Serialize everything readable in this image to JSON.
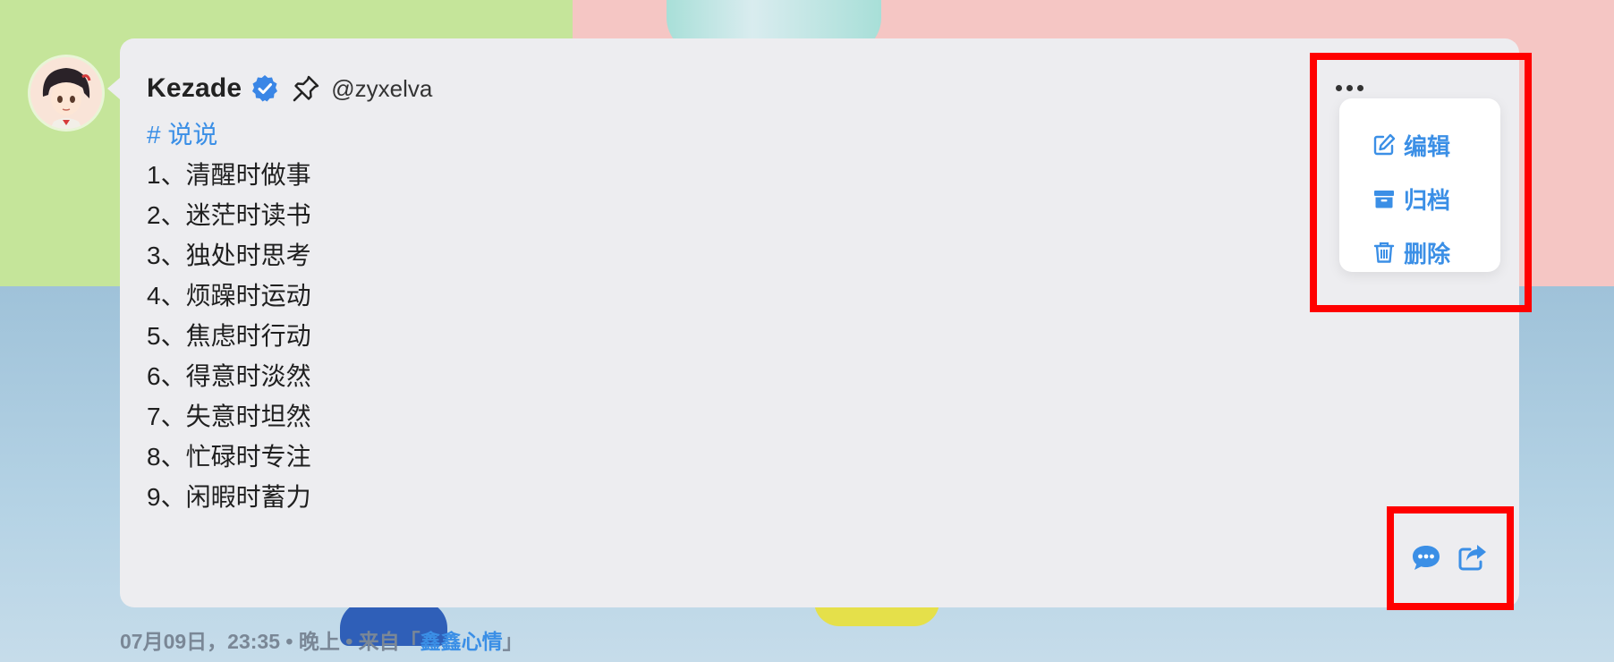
{
  "post": {
    "author_name": "Kezade",
    "handle": "@zyxelva",
    "tag": "# 说说",
    "lines": [
      "1、清醒时做事",
      "2、迷茫时读书",
      "3、独处时思考",
      "4、烦躁时运动",
      "5、焦虑时行动",
      "6、得意时淡然",
      "7、失意时坦然",
      "8、忙碌时专注",
      "9、闲暇时蓄力"
    ]
  },
  "menu": {
    "edit": "编辑",
    "archive": "归档",
    "delete": "删除"
  },
  "footer": {
    "meta": "07月09日，23:35 • 晚上 • 来自「",
    "source": "鑫鑫心情",
    "close": "」"
  },
  "colors": {
    "accent": "#3b8fe6",
    "card_bg": "#ededf0",
    "highlight": "#ff0000"
  },
  "icons": {
    "verified": "verified-badge-icon",
    "pin": "pin-icon",
    "more": "more-horizontal-icon",
    "edit": "edit-icon",
    "archive": "archive-icon",
    "delete": "trash-icon",
    "comment": "comment-icon",
    "share": "share-icon"
  }
}
